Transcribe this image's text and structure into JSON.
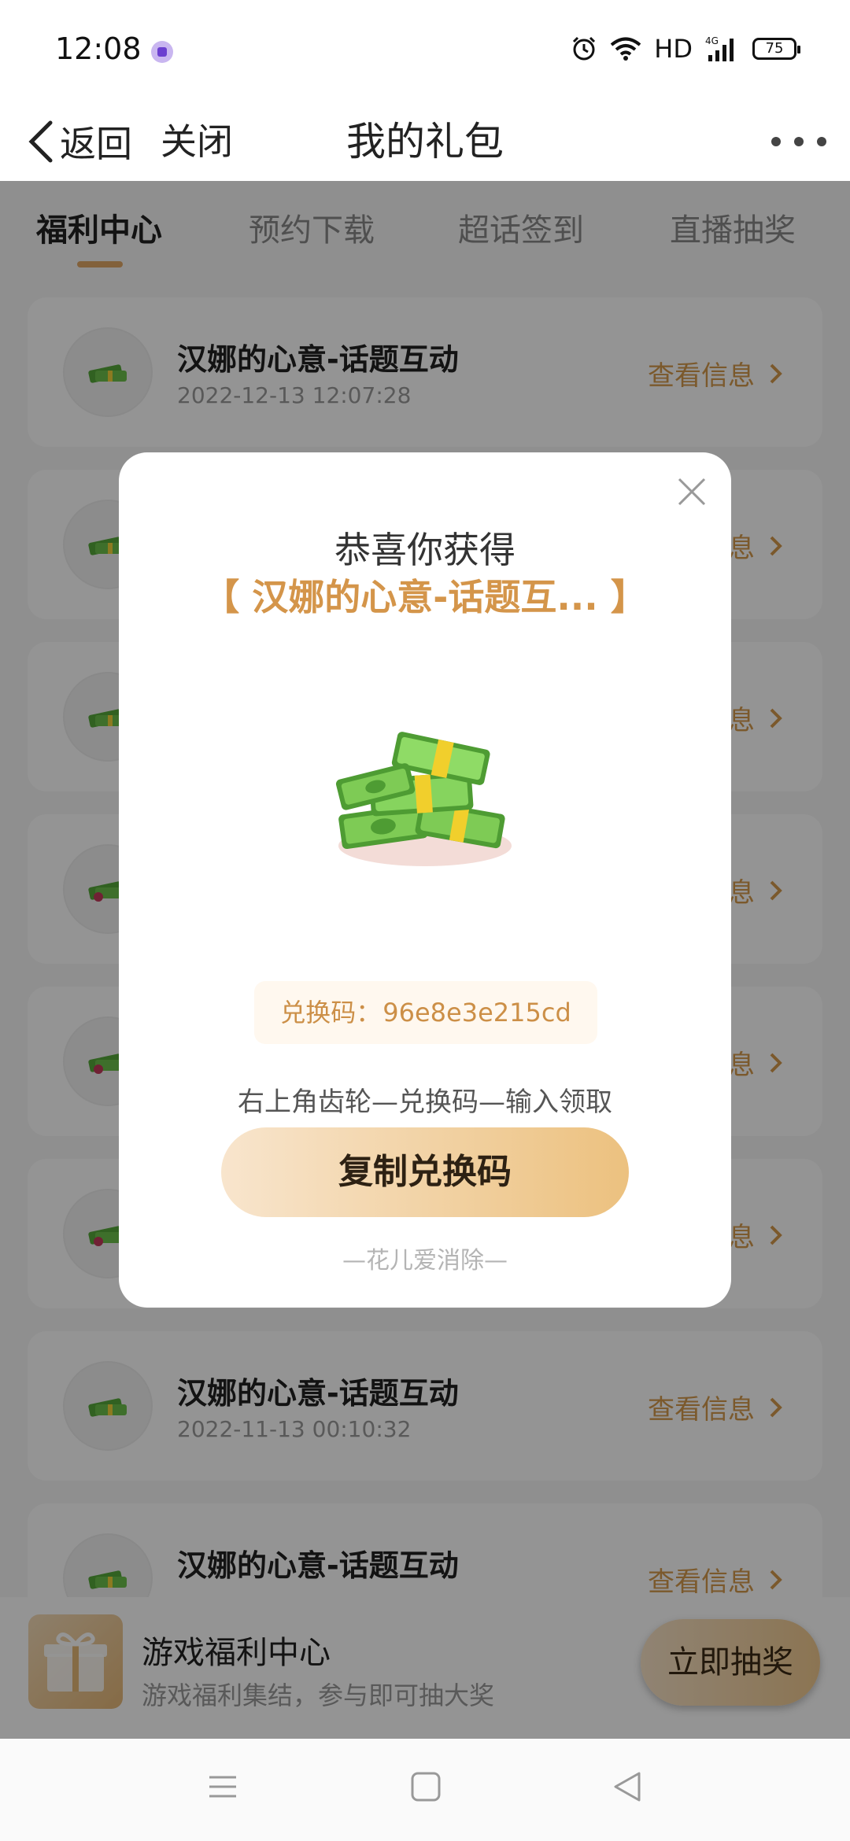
{
  "status_bar": {
    "time": "12:08",
    "network_label": "HD",
    "signal_label": "4G",
    "battery": "75"
  },
  "nav": {
    "back_label": "返回",
    "close_label": "关闭",
    "title": "我的礼包",
    "more_icon": "more-dots-icon"
  },
  "tabs": [
    {
      "label": "福利中心",
      "active": true
    },
    {
      "label": "预约下载",
      "active": false
    },
    {
      "label": "超话签到",
      "active": false
    },
    {
      "label": "直播抽奖",
      "active": false
    }
  ],
  "gift_list": [
    {
      "title": "汉娜的心意-话题互动",
      "time": "2022-12-13 12:07:28",
      "action": "查看信息"
    },
    {
      "title": "",
      "time": "",
      "action": "查看信息"
    },
    {
      "title": "",
      "time": "",
      "action": "查看信息"
    },
    {
      "title": "",
      "time": "",
      "action": "查看信息"
    },
    {
      "title": "",
      "time": "",
      "action": "查看信息"
    },
    {
      "title": "",
      "time": "",
      "action": "查看信息"
    },
    {
      "title": "汉娜的心意-话题互动",
      "time": "2022-11-13 00:10:32",
      "action": "查看信息"
    },
    {
      "title": "汉娜的心意-话题互动",
      "time": "",
      "action": "查看信息"
    }
  ],
  "banner": {
    "title": "游戏福利中心",
    "subtitle": "游戏福利集结，参与即可抽大奖",
    "button_label": "立即抽奖"
  },
  "modal": {
    "heading": "恭喜你获得",
    "gift_name": "【 汉娜的心意-话题互... 】",
    "code_label": "兑换码：",
    "code_value": "96e8e3e215cd",
    "instruction": "右上角齿轮—兑换码—输入领取",
    "copy_button": "复制兑换码",
    "footer": "—花儿爱消除—"
  },
  "colors": {
    "accent": "#d4954a",
    "button_gradient_start": "#f8e5cd",
    "button_gradient_end": "#ecc17f",
    "overlay": "rgba(0,0,0,0.42)"
  }
}
